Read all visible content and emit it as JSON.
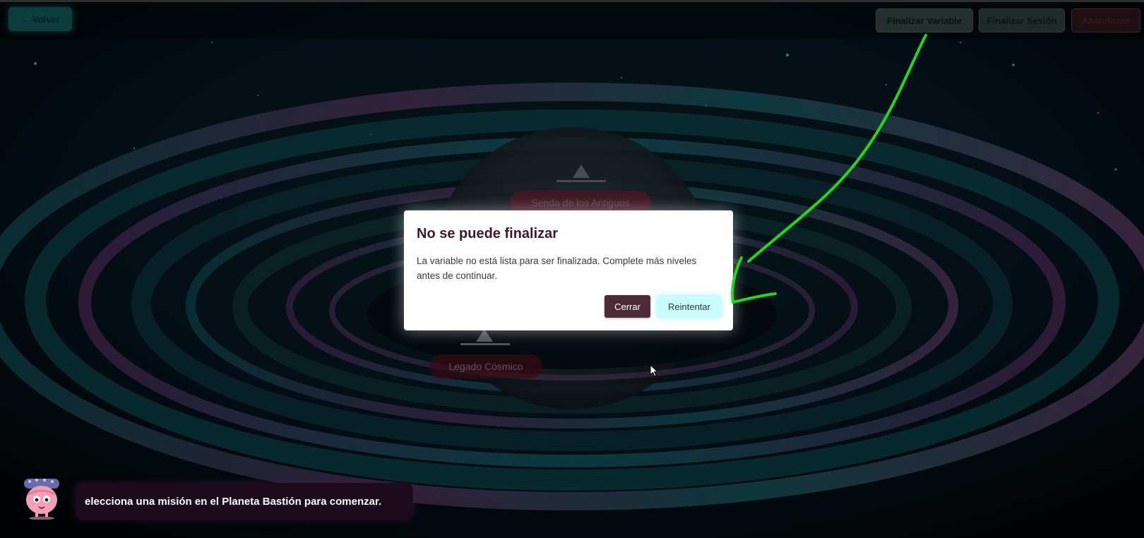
{
  "header": {
    "back_label": "← Volver",
    "finalize_variable_label": "Finalizar Variable",
    "finalize_session_label": "Finalizar Sesión",
    "abandon_label": "Abandonar"
  },
  "map": {
    "missions": [
      {
        "label": "Senda de los Antiguos"
      },
      {
        "label": "Legado Cósmico"
      }
    ]
  },
  "dialog": {
    "title": "No se puede finalizar",
    "message": "La variable no está lista para ser finalizada. Complete más niveles antes de continuar.",
    "close_label": "Cerrar",
    "retry_label": "Reintentar"
  },
  "guide": {
    "message": "elecciona una misión en el Planeta Bastión para comenzar."
  },
  "colors": {
    "annotation_arrow": "#22d81a",
    "dialog_title": "#3d1a24",
    "close_button": "#4d2a37",
    "retry_button": "#c9fbff"
  }
}
